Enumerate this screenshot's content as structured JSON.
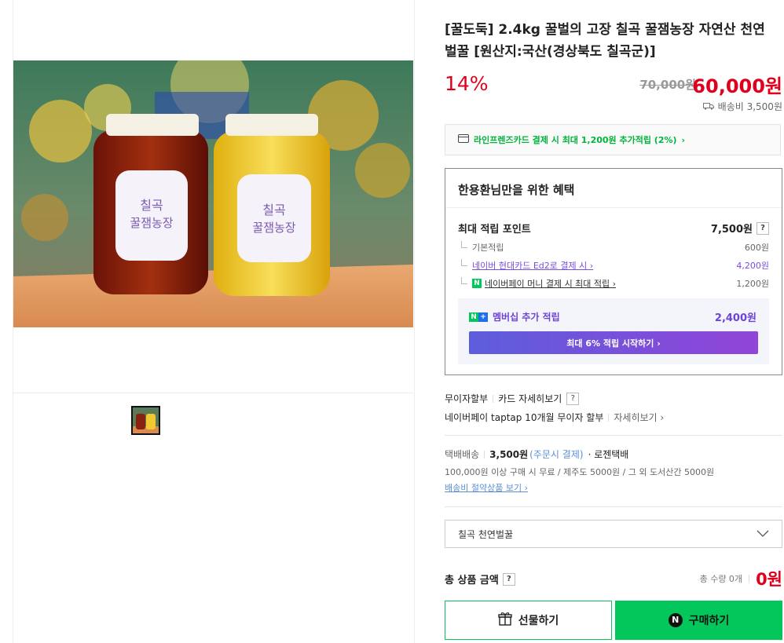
{
  "product": {
    "title": "[꿀도둑] 2.4kg 꿀벌의 고장 칠곡 꿀잼농장 자연산 천연 벌꿀 [원산지:국산(경상북도 칠곡군)]",
    "discount": "14%",
    "original_price": "70,000원",
    "price": "60,000원",
    "shipping_fee": "배송비 3,500원",
    "jar_label_top": "칠곡",
    "jar_label_main": "꿀잼농장"
  },
  "card_banner": {
    "text": "라인프렌즈카드 결제 시 최대 1,200원 추가적립 (2%)",
    "arrow": "›"
  },
  "benefit": {
    "title": "한용환님만을 위한 혜택",
    "max_label": "최대 적립 포인트",
    "max_value": "7,500원",
    "help": "?",
    "items": [
      {
        "label": "기본적립",
        "value": "600원"
      },
      {
        "label": "네이버 현대카드 Ed2로 결제 시 ›",
        "value": "4,200원"
      },
      {
        "label": "네이버페이 머니 결제 시 최대 적립 ›",
        "value": "1,200원"
      }
    ],
    "npay_glyph": "N",
    "membership_label": "멤버십 추가 적립",
    "membership_value": "2,400원",
    "membership_button": "최대 6% 적립 시작하기 ›"
  },
  "installment": {
    "label1": "무이자할부",
    "link1": "카드 자세히보기",
    "line2": "네이버페이 taptap 10개월 무이자 할부",
    "link2": "자세히보기 ›"
  },
  "delivery": {
    "type": "택배배송",
    "fee": "3,500원",
    "fee_note": "(주문시 결제)",
    "carrier": "· 로젠택배",
    "condition": "100,000원 이상 구매 시 무료 / 제주도 5000원 / 그 외 도서산간 5000원",
    "saving_link": "배송비 절약상품 보기 ›"
  },
  "option": {
    "selected": "칠곡 천연벌꿀"
  },
  "total": {
    "label": "총 상품 금액",
    "help": "?",
    "qty": "총 수량 0개",
    "price": "0원"
  },
  "buttons": {
    "gift": "선물하기",
    "buy": "구매하기",
    "buy_glyph": "N"
  },
  "colors": {
    "accent_red": "#e0001c",
    "naver_green": "#03c75a",
    "membership_purple": "#7a4cde"
  }
}
